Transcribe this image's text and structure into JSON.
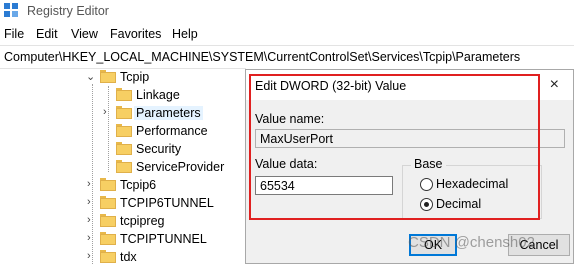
{
  "window": {
    "title": "Registry Editor"
  },
  "menu": {
    "items": [
      "File",
      "Edit",
      "View",
      "Favorites",
      "Help"
    ]
  },
  "address": {
    "path": "Computer\\HKEY_LOCAL_MACHINE\\SYSTEM\\CurrentControlSet\\Services\\Tcpip\\Parameters"
  },
  "tree": {
    "tcpip": "Tcpip",
    "linkage": "Linkage",
    "parameters": "Parameters",
    "performance": "Performance",
    "security": "Security",
    "serviceprovider": "ServiceProvider",
    "tcpip6": "Tcpip6",
    "tcpip6tunnel": "TCPIP6TUNNEL",
    "tcpipreg": "tcpipreg",
    "tcpiptunnel": "TCPIPTUNNEL",
    "tdx": "tdx"
  },
  "dialog": {
    "title": "Edit DWORD (32-bit) Value",
    "close_glyph": "×",
    "value_name_label": "Value name:",
    "value_name": "MaxUserPort",
    "value_data_label": "Value data:",
    "value_data": "65534",
    "base_label": "Base",
    "hex_label": "Hexadecimal",
    "dec_label": "Decimal",
    "base_selected": "Decimal",
    "ok_label": "OK",
    "cancel_label": "Cancel"
  },
  "watermark": "CSDN @chensh02",
  "colors": {
    "highlight": "#e02020",
    "accent": "#0078d7",
    "selection": "#e5f3ff"
  }
}
